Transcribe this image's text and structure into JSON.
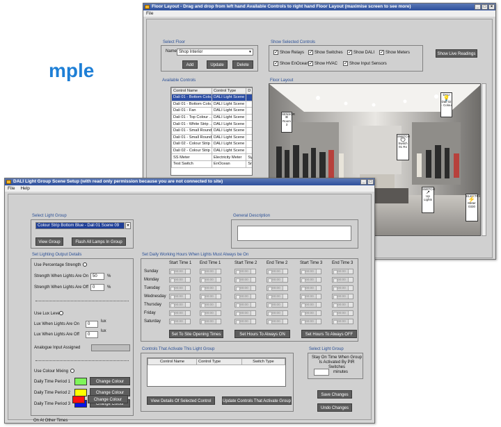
{
  "background_text": "mple",
  "floor_window": {
    "title": "Floor Layout - Drag and drop from left hand Available Controls to right hand Floor Layout (maximise screen to see more)",
    "menu": [
      "File"
    ],
    "select_floor": {
      "group_title": "Select Floor",
      "name_label": "Name",
      "name_value": "Shop Interior",
      "add_label": "Add",
      "update_label": "Update",
      "delete_label": "Delete"
    },
    "show_controls": {
      "group_title": "Show Selected Controls",
      "checkboxes": [
        {
          "label": "Show Relays",
          "checked": true
        },
        {
          "label": "Show Switches",
          "checked": true
        },
        {
          "label": "Show DALI",
          "checked": true
        },
        {
          "label": "Show Meters",
          "checked": true
        },
        {
          "label": "Show EnOcean",
          "checked": true
        },
        {
          "label": "Show HVAC",
          "checked": true
        },
        {
          "label": "Show Input Sensors",
          "checked": true
        }
      ]
    },
    "live_readings_label": "Show Live Readings",
    "available_controls": {
      "group_title": "Available Controls",
      "columns": [
        "Control Name",
        "Control Type",
        "D"
      ],
      "rows": [
        [
          "Dali 01 - Bottom Colo...",
          "DALI Light Scene",
          ""
        ],
        [
          "Dali 01 - Bottom Colo...",
          "DALI Light Scene",
          ""
        ],
        [
          "Dali 01 - Fan",
          "DALI Light Scene",
          ""
        ],
        [
          "Dali 01 - Top Colour ...",
          "DALI Light Scene",
          ""
        ],
        [
          "Dali 01 - White Strip ...",
          "DALI Light Scene",
          ""
        ],
        [
          "Dali 01 - Small Round...",
          "DALI Light Scene",
          ""
        ],
        [
          "Dali 01 - Small Round...",
          "DALI Light Scene",
          ""
        ],
        [
          "Dali 02 - Colour Strip ...",
          "DALI Light Scene",
          ""
        ],
        [
          "Dali 02 - Colour Strip ...",
          "DALI Light Scene",
          ""
        ],
        [
          "SS Meter",
          "Electricity Meter",
          "Sy"
        ],
        [
          "Test Switch",
          "EnOcean",
          "Sr"
        ]
      ]
    },
    "floor_layout": {
      "group_title": "Floor Layout",
      "devices": [
        {
          "name": "SENSOR",
          "label": "Room 3"
        },
        {
          "name": "DALI",
          "label": "Dali 02 - Colou"
        },
        {
          "name": "SWITCH",
          "label": "Switch 01 Ro"
        },
        {
          "name": "SWITCH",
          "label": "Up Lights"
        },
        {
          "name": "ELECTRIC",
          "label": "Meter 0330"
        }
      ]
    }
  },
  "dali_window": {
    "title": "DALI Light Group Scene Setup (with read only permission because you are not connected to site)",
    "menu": [
      "File",
      "Help"
    ],
    "select_light_group": {
      "group_title": "Select Light Group",
      "value": "Colour Strip Bottom Blue - Dali 01 Scene 09",
      "view_group_label": "View Group",
      "flash_label": "Flash All Lamps In Group"
    },
    "general_description": {
      "group_title": "General Description",
      "value": ""
    },
    "output_details": {
      "group_title": "Set Lighting Output Details",
      "use_percentage_label": "Use Percentage Strength",
      "strength_on_label": "Strength When Lights Are On",
      "strength_on_value": "50",
      "strength_off_label": "Strength When Lights Are Off",
      "strength_off_value": "0",
      "percent_unit": "%",
      "use_lux_label": "Use Lux Level",
      "lux_on_label": "Lux When Lights Are On",
      "lux_on_value": "0",
      "lux_off_label": "Lux When Lights Are Off",
      "lux_off_value": "0",
      "lux_unit": "lux",
      "analogue_label": "Analogue Input Assigned",
      "use_colour_label": "Use Colour Mixing",
      "colour_rows": [
        {
          "label": "Daily Time Period 1",
          "color": "#7ff55a",
          "button": "Change Colour"
        },
        {
          "label": "Daily Time Period 2",
          "color": "#ffff00",
          "button": "Change Colour"
        },
        {
          "label": "Daily Time Period 3",
          "color": "#0a14e6",
          "button": "Change Colour"
        },
        {
          "label": "On At Other Times",
          "color": "#ff1010",
          "button": "Change Colour"
        }
      ]
    },
    "working_hours": {
      "group_title": "Set Daily Working Hours When Lights Must Always be On",
      "columns": [
        "Start Time 1",
        "End Time 1",
        "Start Time 2",
        "End Time 2",
        "Start Time 3",
        "End Time 3"
      ],
      "days": [
        "Sunday",
        "Monday",
        "Tuesday",
        "Wednesday",
        "Thursday",
        "Friday",
        "Saturday"
      ],
      "time_value": "00:00",
      "btn_opening": "Set To Site Opening Times",
      "btn_on": "Set Hours To Always ON",
      "btn_off": "Set Hours To Always OFF"
    },
    "controls_activate": {
      "group_title": "Controls That Activate This Light Group",
      "columns": [
        "Control Name",
        "Control Type",
        "Switch Type"
      ],
      "btn_view": "View Details Of Selected Control",
      "btn_update": "Update Controls That Activate Group"
    },
    "select_group_right": {
      "group_title": "Select Light Group",
      "desc": "Stay On Time When Group Is Activated By PIR Switches",
      "minutes_value": "",
      "minutes_label": "minutes"
    },
    "save_label": "Save Changes",
    "undo_label": "Undo Changes"
  }
}
